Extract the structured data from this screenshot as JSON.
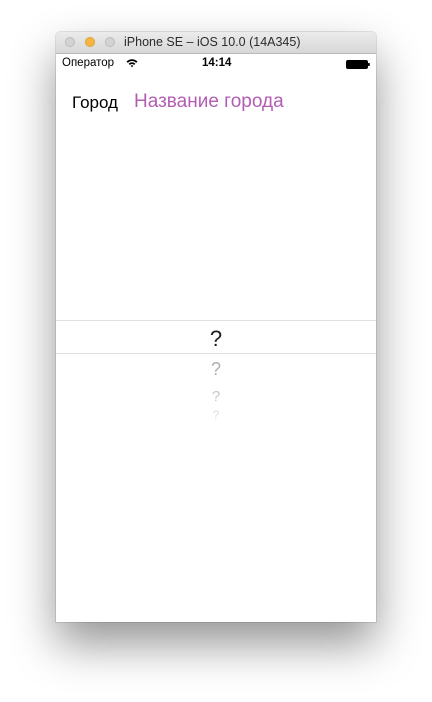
{
  "window": {
    "title": "iPhone SE – iOS 10.0 (14A345)"
  },
  "status_bar": {
    "carrier": "Оператор",
    "time": "14:14",
    "icons": [
      "wifi-icon",
      "battery-icon"
    ]
  },
  "form": {
    "city_label": "Город",
    "city_placeholder": "Название города"
  },
  "picker": {
    "rows": [
      "?",
      "?",
      "?",
      "?"
    ],
    "selected_index": 0
  },
  "colors": {
    "placeholder": "#b35db3",
    "minimize_light": "#f5b541"
  }
}
